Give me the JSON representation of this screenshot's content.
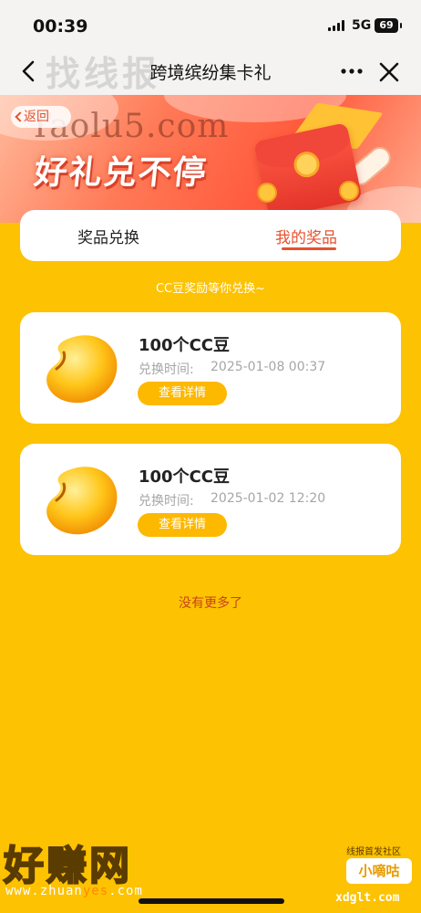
{
  "status": {
    "time": "00:39",
    "network": "5G",
    "battery": "69"
  },
  "nav": {
    "title": "跨境缤纷集卡礼",
    "watermark": "找线报",
    "more_icon": "more-icon",
    "close_icon": "close-icon"
  },
  "banner": {
    "back_label": "返回",
    "watermark": "Taolu5.com",
    "slogan": "好礼兑不停"
  },
  "tabs": [
    {
      "label": "奖品兑换",
      "active": false
    },
    {
      "label": "我的奖品",
      "active": true
    }
  ],
  "hint": "CC豆奖励等你兑换~",
  "prizes": [
    {
      "name": "100个CC豆",
      "time_label": "兑换时间:",
      "time": "2025-01-08 00:37",
      "button": "查看详情"
    },
    {
      "name": "100个CC豆",
      "time_label": "兑换时间:",
      "time": "2025-01-02 12:20",
      "button": "查看详情"
    }
  ],
  "footer": {
    "no_more": "没有更多了"
  },
  "watermarks": {
    "bottom_left": "好赚网",
    "url_prefix": "www.zhuan",
    "url_mid": "yes",
    "url_suffix": ".com",
    "right_top": "线报首发社区",
    "right_logo": "小嘀咕",
    "right_url": "xdglt.com"
  },
  "colors": {
    "background": "#fdc201",
    "accent": "#e4532f",
    "button": "#fdb800"
  }
}
